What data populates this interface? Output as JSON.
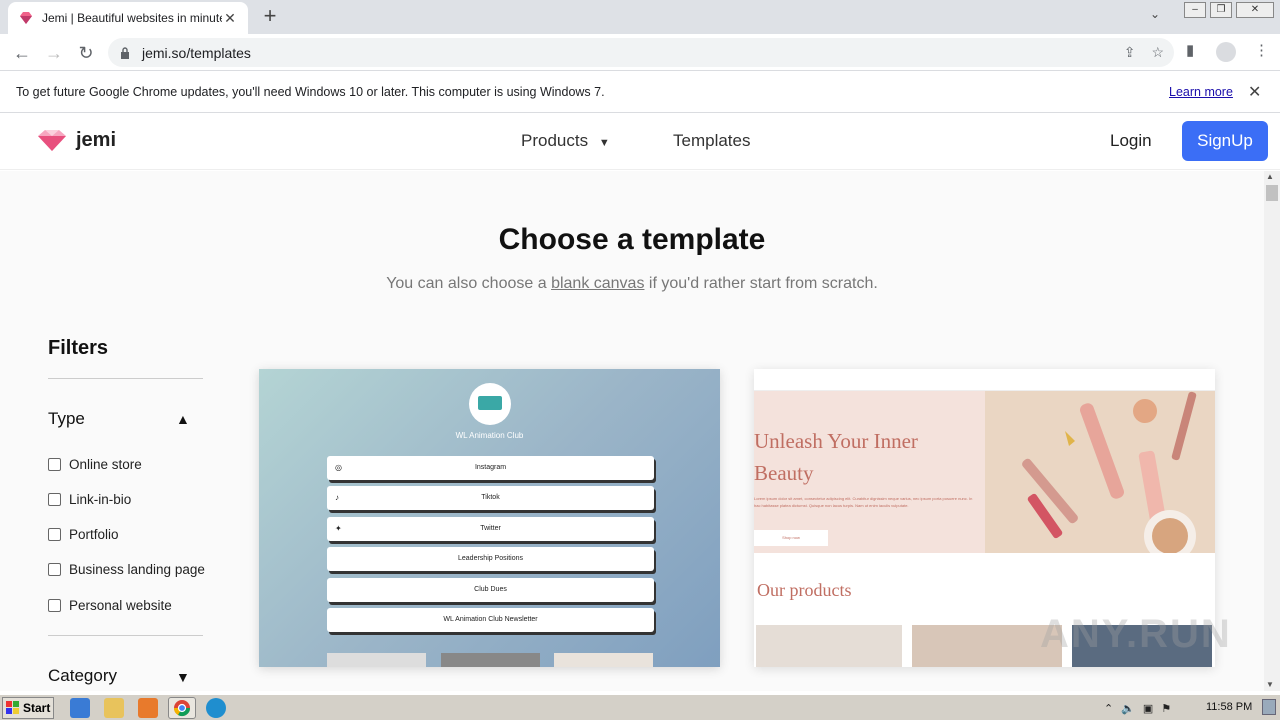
{
  "browser": {
    "tab_title": "Jemi | Beautiful websites in minutes",
    "url": "jemi.so/templates",
    "infobar_message": "To get future Google Chrome updates, you'll need Windows 10 or later. This computer is using Windows 7.",
    "infobar_link": "Learn more"
  },
  "site": {
    "logo_text": "jemi",
    "nav": {
      "products": "Products",
      "templates": "Templates"
    },
    "login": "Login",
    "signup": "SignUp"
  },
  "page": {
    "title": "Choose a template",
    "subtitle_before": "You can also choose a ",
    "subtitle_link": "blank canvas",
    "subtitle_after": " if you'd rather start from scratch."
  },
  "filters": {
    "title": "Filters",
    "type_title": "Type",
    "type_options": [
      "Online store",
      "Link-in-bio",
      "Portfolio",
      "Business landing page",
      "Personal website"
    ],
    "category_title": "Category"
  },
  "templates": {
    "card1": {
      "name": "WL Animation Club",
      "buttons": [
        "Instagram",
        "Tiktok",
        "Twitter",
        "Leadership Positions",
        "Club Dues",
        "WL Animation Club Newsletter"
      ]
    },
    "card2": {
      "headline": "Unleash Your Inner Beauty",
      "body": "Lorem ipsum dolor sit amet, consectetur adipiscing elit. Curabitur dignissim neque varius, nec ipsum porta posuere nunc. In hac habitasse platea dictumst. Quisque non lacus turpis. Nam ut enim iaculis vulputate.",
      "shop_button": "Shop now",
      "products_title": "Our products"
    }
  },
  "watermark": "ANY.RUN",
  "taskbar": {
    "start": "Start",
    "clock": "11:58 PM"
  },
  "colors": {
    "accent": "#3b6ef6",
    "card2_accent": "#c06e62"
  }
}
